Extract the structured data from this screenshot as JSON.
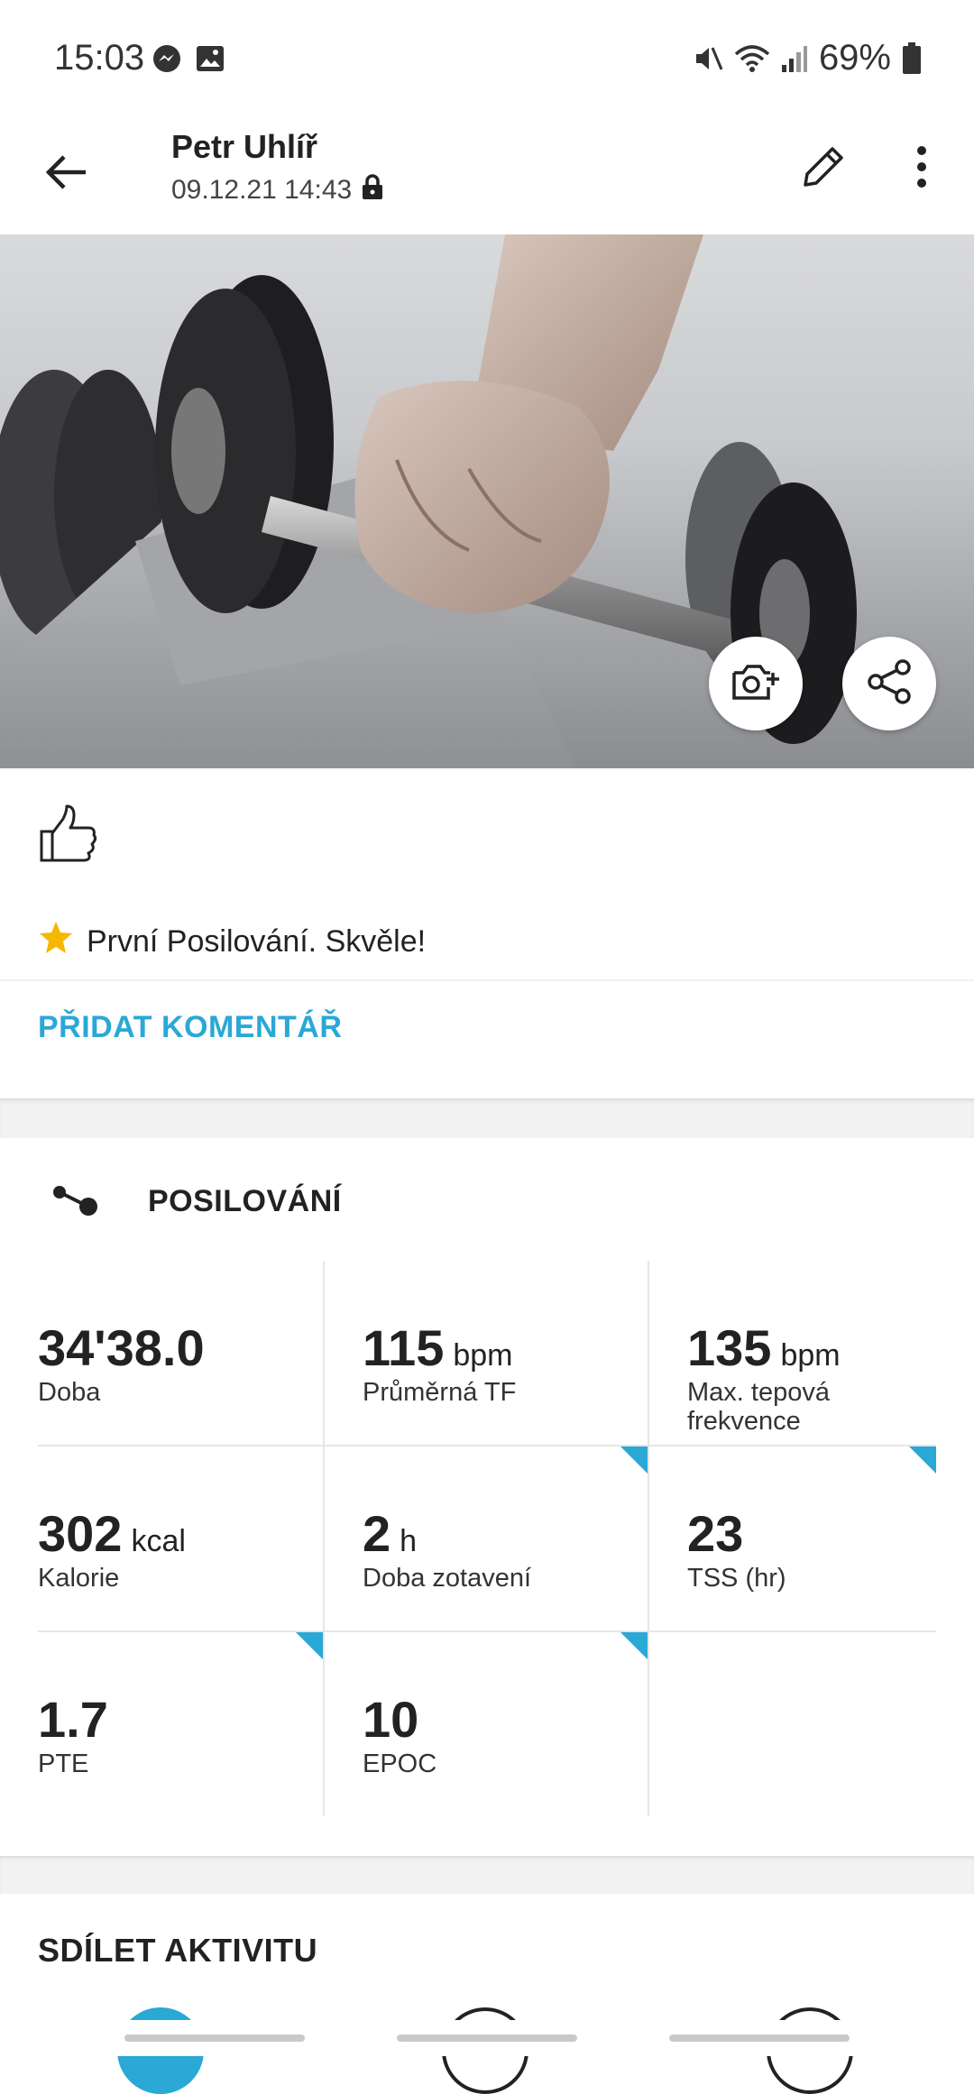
{
  "status_bar": {
    "time": "15:03",
    "battery": "69%",
    "icons": [
      "messenger-icon",
      "gallery-icon",
      "mute-icon",
      "wifi-icon",
      "signal-icon",
      "battery-icon"
    ]
  },
  "header": {
    "user_name": "Petr Uhlíř",
    "datetime": "09.12.21 14:43",
    "icons": [
      "back-arrow-icon",
      "lock-icon",
      "pencil-icon",
      "more-vert-icon"
    ]
  },
  "hero": {
    "icons": [
      "add-photo-icon",
      "share-icon"
    ]
  },
  "feed": {
    "achievement_text": "První Posilování. Skvěle!",
    "add_comment_label": "PŘIDAT KOMENTÁŘ"
  },
  "activity": {
    "title": "POSILOVÁNÍ",
    "stats": [
      {
        "value": "34'38.0",
        "unit": "",
        "label": "Doba",
        "corner": false
      },
      {
        "value": "115",
        "unit": "bpm",
        "label": "Průměrná TF",
        "corner": true
      },
      {
        "value": "135",
        "unit": "bpm",
        "label": "Max. tepová frekvence",
        "corner": true
      },
      {
        "value": "302",
        "unit": "kcal",
        "label": "Kalorie",
        "corner": true
      },
      {
        "value": "2",
        "unit": "h",
        "label": "Doba zotavení",
        "corner": true
      },
      {
        "value": "23",
        "unit": "",
        "label": "TSS (hr)",
        "corner": false
      },
      {
        "value": "1.7",
        "unit": "",
        "label": "PTE",
        "corner": false
      },
      {
        "value": "10",
        "unit": "",
        "label": "EPOC",
        "corner": false
      }
    ]
  },
  "share": {
    "title": "SDÍLET AKTIVITU"
  },
  "colors": {
    "accent": "#2aa8d6",
    "star": "#f5b800",
    "text": "#222222"
  }
}
